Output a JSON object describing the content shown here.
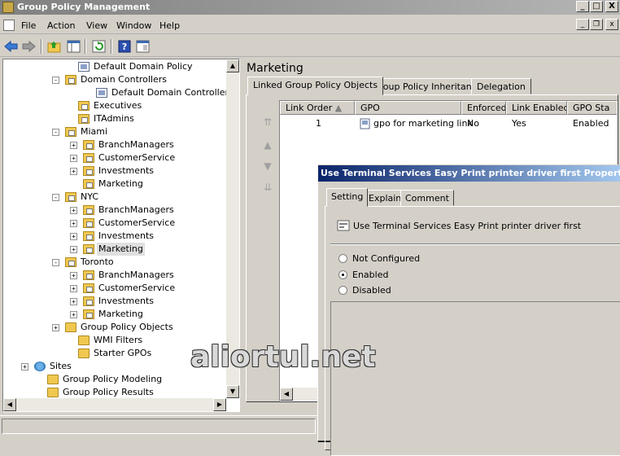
{
  "window": {
    "title": "Group Policy Management"
  },
  "title_buttons": {
    "minimize": "_",
    "maximize": "□",
    "close": "X"
  },
  "menubar": {
    "items": [
      "File",
      "Action",
      "View",
      "Window",
      "Help"
    ]
  },
  "tree": {
    "rows": [
      {
        "label": "Default Domain Policy",
        "icon": "gpo-link-icon"
      },
      {
        "label": "Domain Controllers",
        "icon": "ou-folder-icon",
        "exp": "−"
      },
      {
        "label": "Default Domain Controllers Policy",
        "icon": "gpo-link-icon"
      },
      {
        "label": "Executives",
        "icon": "ou-folder-icon"
      },
      {
        "label": "ITAdmins",
        "icon": "ou-folder-icon"
      },
      {
        "label": "Miami",
        "icon": "ou-folder-icon",
        "exp": "−"
      },
      {
        "label": "BranchManagers",
        "icon": "ou-folder-icon",
        "exp": "+"
      },
      {
        "label": "CustomerService",
        "icon": "ou-folder-icon",
        "exp": "+"
      },
      {
        "label": "Investments",
        "icon": "ou-folder-icon",
        "exp": "+"
      },
      {
        "label": "Marketing",
        "icon": "ou-folder-icon"
      },
      {
        "label": "NYC",
        "icon": "ou-folder-icon",
        "exp": "−"
      },
      {
        "label": "BranchManagers",
        "icon": "ou-folder-icon",
        "exp": "+"
      },
      {
        "label": "CustomerService",
        "icon": "ou-folder-icon",
        "exp": "+"
      },
      {
        "label": "Investments",
        "icon": "ou-folder-icon",
        "exp": "+"
      },
      {
        "label": "Marketing",
        "icon": "ou-folder-icon",
        "exp": "+",
        "selected": true
      },
      {
        "label": "Toronto",
        "icon": "ou-folder-icon",
        "exp": "−"
      },
      {
        "label": "BranchManagers",
        "icon": "ou-folder-icon",
        "exp": "+"
      },
      {
        "label": "CustomerService",
        "icon": "ou-folder-icon",
        "exp": "+"
      },
      {
        "label": "Investments",
        "icon": "ou-folder-icon",
        "exp": "+"
      },
      {
        "label": "Marketing",
        "icon": "ou-folder-icon",
        "exp": "+"
      },
      {
        "label": "Group Policy Objects",
        "icon": "gpo-folder-icon",
        "exp": "+"
      },
      {
        "label": "WMI Filters",
        "icon": "wmi-folder-icon"
      },
      {
        "label": "Starter GPOs",
        "icon": "starter-folder-icon"
      },
      {
        "label": "Sites",
        "icon": "sites-icon",
        "exp": "+"
      },
      {
        "label": "Group Policy Modeling",
        "icon": "modeling-icon"
      },
      {
        "label": "Group Policy Results",
        "icon": "results-icon"
      }
    ]
  },
  "right_pane": {
    "title": "Marketing",
    "tabs": [
      "Linked Group Policy Objects",
      "Group Policy Inheritance",
      "Delegation"
    ],
    "columns": [
      "Link Order",
      "GPO",
      "Enforced",
      "Link Enabled",
      "GPO Sta"
    ],
    "rows": [
      {
        "link_order": "1",
        "gpo": "gpo for marketing link",
        "enforced": "No",
        "link_enabled": "Yes",
        "gpo_status": "Enabled"
      }
    ]
  },
  "dialog": {
    "title": "Use Terminal Services Easy Print printer driver first Properties",
    "tabs": [
      "Setting",
      "Explain",
      "Comment"
    ],
    "setting_name": "Use Terminal Services Easy Print printer driver first",
    "options": [
      "Not Configured",
      "Enabled",
      "Disabled"
    ],
    "selected_option": "Enabled"
  },
  "watermark": "aliortul.net",
  "colors": {
    "titlebar": "#808080",
    "dialog_title": "#0a246a",
    "selection": "#e0e0e0"
  }
}
